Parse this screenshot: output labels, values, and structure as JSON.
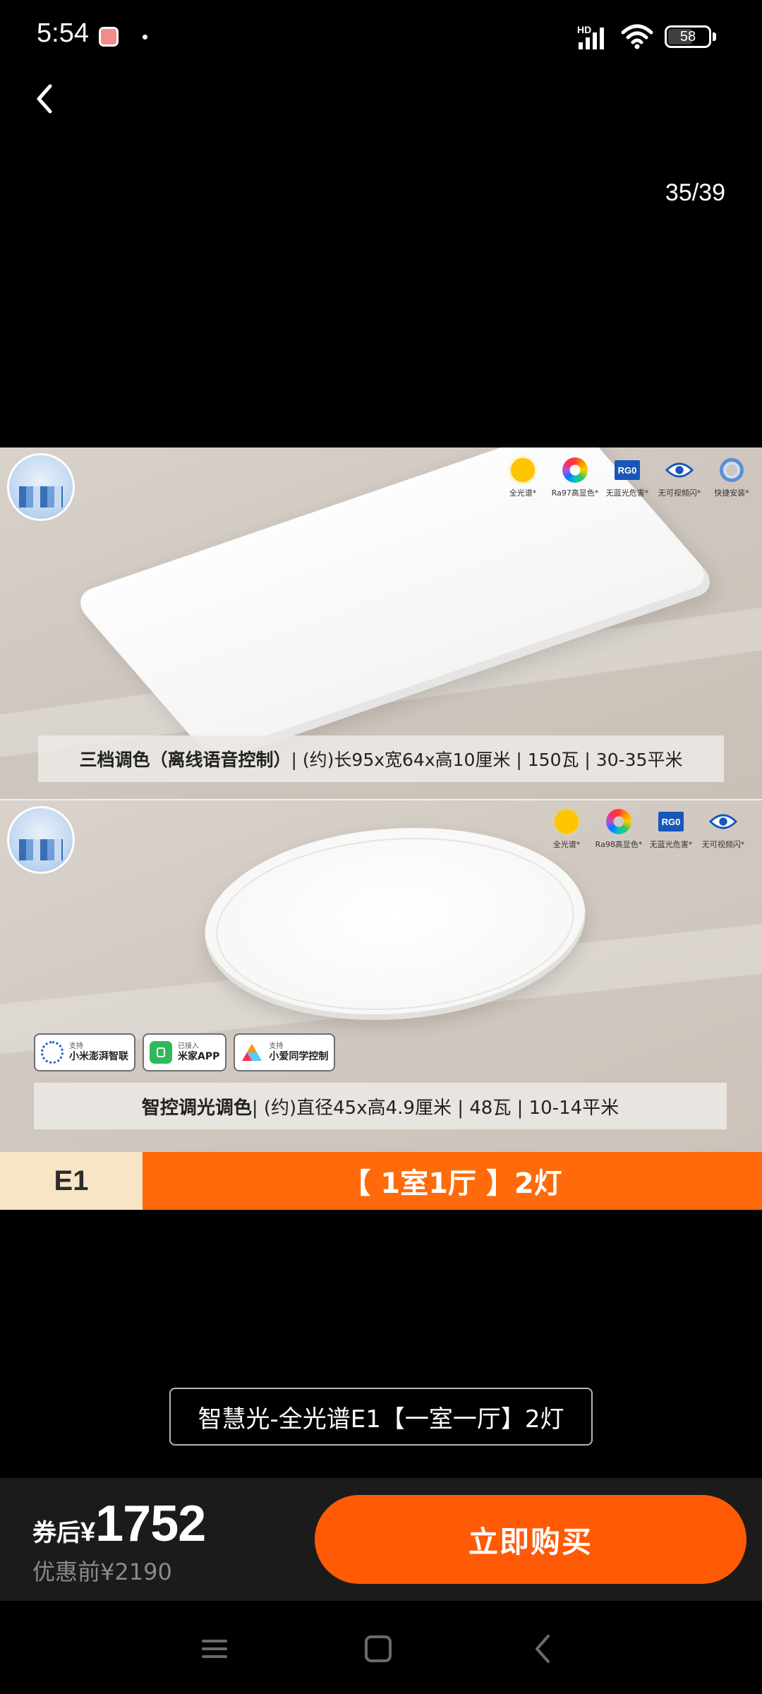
{
  "status_bar": {
    "time": "5:54",
    "network": "HD",
    "battery": "58"
  },
  "header": {
    "page_counter": "35/39"
  },
  "product_image": {
    "top_panel": {
      "features": [
        {
          "icon": "sun-icon",
          "label": "全光谱*"
        },
        {
          "icon": "color-wheel-icon",
          "label": "Ra97高显色*"
        },
        {
          "icon": "rg0-icon",
          "label": "无蓝光危害*"
        },
        {
          "icon": "eye-icon",
          "label": "无可视频闪*"
        },
        {
          "icon": "ring-icon",
          "label": "快捷安装*"
        }
      ],
      "spec_strong": "三档调色（离线语音控制）",
      "spec_rest": "| (约)长95x宽64x高10厘米 | 150瓦 | 30-35平米"
    },
    "bottom_panel": {
      "features": [
        {
          "icon": "sun-icon",
          "label": "全光谱*"
        },
        {
          "icon": "color-wheel-icon",
          "label": "Ra98高显色*"
        },
        {
          "icon": "rg0-icon",
          "label": "无蓝光危害*"
        },
        {
          "icon": "eye-icon",
          "label": "无可视频闪*"
        }
      ],
      "badges": [
        {
          "icon": "hyperos-icon",
          "small": "支持",
          "main": "小米澎湃智联"
        },
        {
          "icon": "mijia-icon",
          "small": "已接入",
          "main": "米家APP"
        },
        {
          "icon": "xiaoai-icon",
          "small": "支持",
          "main": "小爱同学控制"
        }
      ],
      "spec_strong": "智控调光调色",
      "spec_rest": "| (约)直径45x高4.9厘米 | 48瓦 | 10-14平米"
    },
    "variant": {
      "model": "E1",
      "description": "【 1室1厅 】2灯"
    },
    "rg0_text": "RG0"
  },
  "caption": "智慧光-全光谱E1【一室一厅】2灯",
  "purchase": {
    "price_prefix": "券后",
    "currency": "¥",
    "price": "1752",
    "original_price": "优惠前¥2190",
    "buy_label": "立即购买",
    "accent_color": "#ff5a05"
  },
  "nav_bar": {
    "items": [
      "menu-icon",
      "home-icon",
      "back-icon"
    ]
  }
}
